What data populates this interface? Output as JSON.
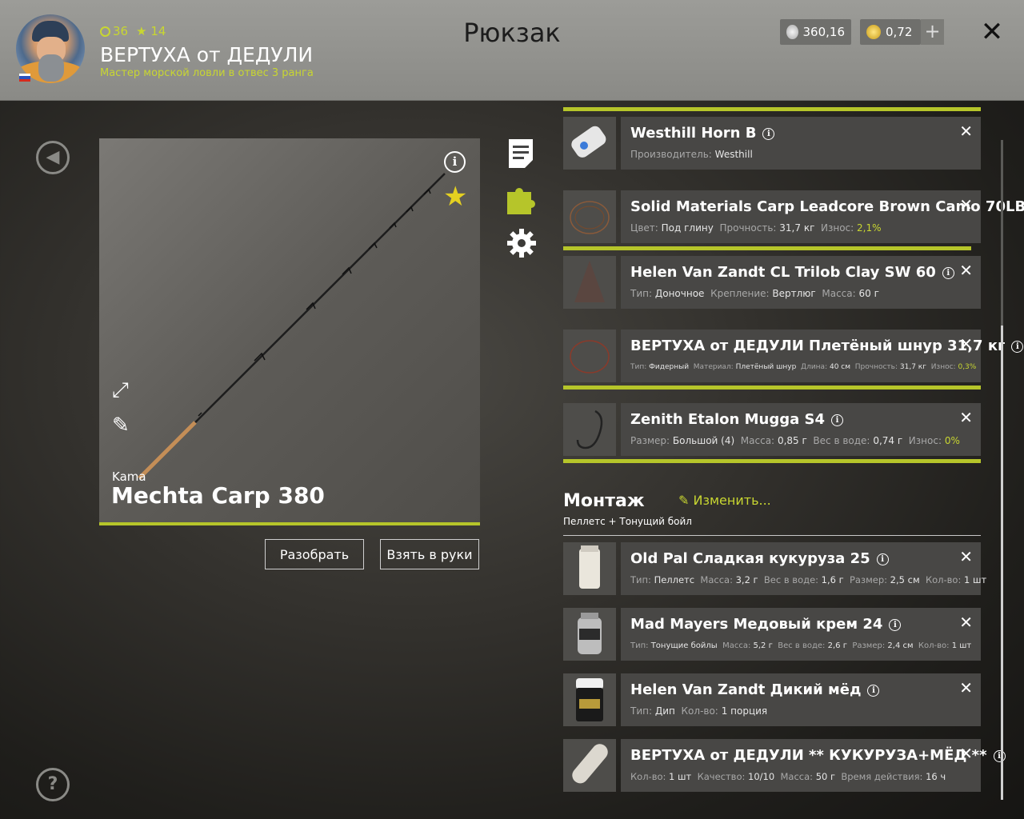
{
  "player": {
    "level": "36",
    "stars": "14",
    "name": "ВЕРТУХА от ДЕДУЛИ",
    "rank": "Мастер морской ловли в отвес 3 ранга"
  },
  "page_title": "Рюкзак",
  "currency": {
    "silver": "360,16",
    "gold": "0,72"
  },
  "rod": {
    "brand": "Kama",
    "name": "Mechta Carp 380"
  },
  "buttons": {
    "disassemble": "Разобрать",
    "take": "Взять в руки"
  },
  "montage": {
    "title": "Монтаж",
    "edit": "Изменить...",
    "subtitle": "Пеллетс + Тонущий бойл"
  },
  "items": [
    {
      "title": "Westhill Horn B",
      "sub": [
        {
          "k": "Производитель:",
          "v": "Westhill"
        }
      ]
    },
    {
      "title": "Solid Materials Carp Leadcore Brown Camo 70LB",
      "sub": [
        {
          "k": "Цвет:",
          "v": "Под глину"
        },
        {
          "k": "Прочность:",
          "v": "31,7 кг"
        },
        {
          "k": "Износ:",
          "v": "2,1%",
          "g": true
        }
      ]
    },
    {
      "title": "Helen Van Zandt CL Trilob Clay SW 60",
      "sub": [
        {
          "k": "Тип:",
          "v": "Доночное"
        },
        {
          "k": "Крепление:",
          "v": "Вертлюг"
        },
        {
          "k": "Масса:",
          "v": "60 г"
        }
      ]
    },
    {
      "title": "ВЕРТУХА от ДЕДУЛИ Плетёный шнур 31,7 кг",
      "tiny": true,
      "sub": [
        {
          "k": "Тип:",
          "v": "Фидерный"
        },
        {
          "k": "Материал:",
          "v": "Плетёный шнур"
        },
        {
          "k": "Длина:",
          "v": "40 см"
        },
        {
          "k": "Прочность:",
          "v": "31,7 кг"
        },
        {
          "k": "Износ:",
          "v": "0,3%",
          "g": true
        }
      ]
    },
    {
      "title": "Zenith Etalon Mugga S4",
      "sub": [
        {
          "k": "Размер:",
          "v": "Большой (4)"
        },
        {
          "k": "Масса:",
          "v": "0,85 г"
        },
        {
          "k": "Вес в воде:",
          "v": "0,74 г"
        },
        {
          "k": "Износ:",
          "v": "0%",
          "g": true
        }
      ]
    },
    {
      "title": "Old Pal Сладкая кукуруза 25",
      "sub": [
        {
          "k": "Тип:",
          "v": "Пеллетс"
        },
        {
          "k": "Масса:",
          "v": "3,2 г"
        },
        {
          "k": "Вес в воде:",
          "v": "1,6 г"
        },
        {
          "k": "Размер:",
          "v": "2,5 см"
        },
        {
          "k": "Кол-во:",
          "v": "1 шт"
        }
      ]
    },
    {
      "title": "Mad Mayers Медовый крем 24",
      "tiny": true,
      "sub": [
        {
          "k": "Тип:",
          "v": "Тонущие бойлы"
        },
        {
          "k": "Масса:",
          "v": "5,2 г"
        },
        {
          "k": "Вес в воде:",
          "v": "2,6 г"
        },
        {
          "k": "Размер:",
          "v": "2,4 см"
        },
        {
          "k": "Кол-во:",
          "v": "1 шт"
        }
      ]
    },
    {
      "title": "Helen Van Zandt Дикий мёд",
      "sub": [
        {
          "k": "Тип:",
          "v": "Дип"
        },
        {
          "k": "Кол-во:",
          "v": "1 порция"
        }
      ]
    },
    {
      "title": "ВЕРТУХА от ДЕДУЛИ ** КУКУРУЗА+МЁД **",
      "sub": [
        {
          "k": "Кол-во:",
          "v": "1 шт"
        },
        {
          "k": "Качество:",
          "v": "10/10"
        },
        {
          "k": "Масса:",
          "v": "50 г"
        },
        {
          "k": "Время действия:",
          "v": "16 ч"
        }
      ]
    }
  ],
  "colors": {
    "accent": "#b6c52a",
    "highlight": "#c8d631"
  }
}
